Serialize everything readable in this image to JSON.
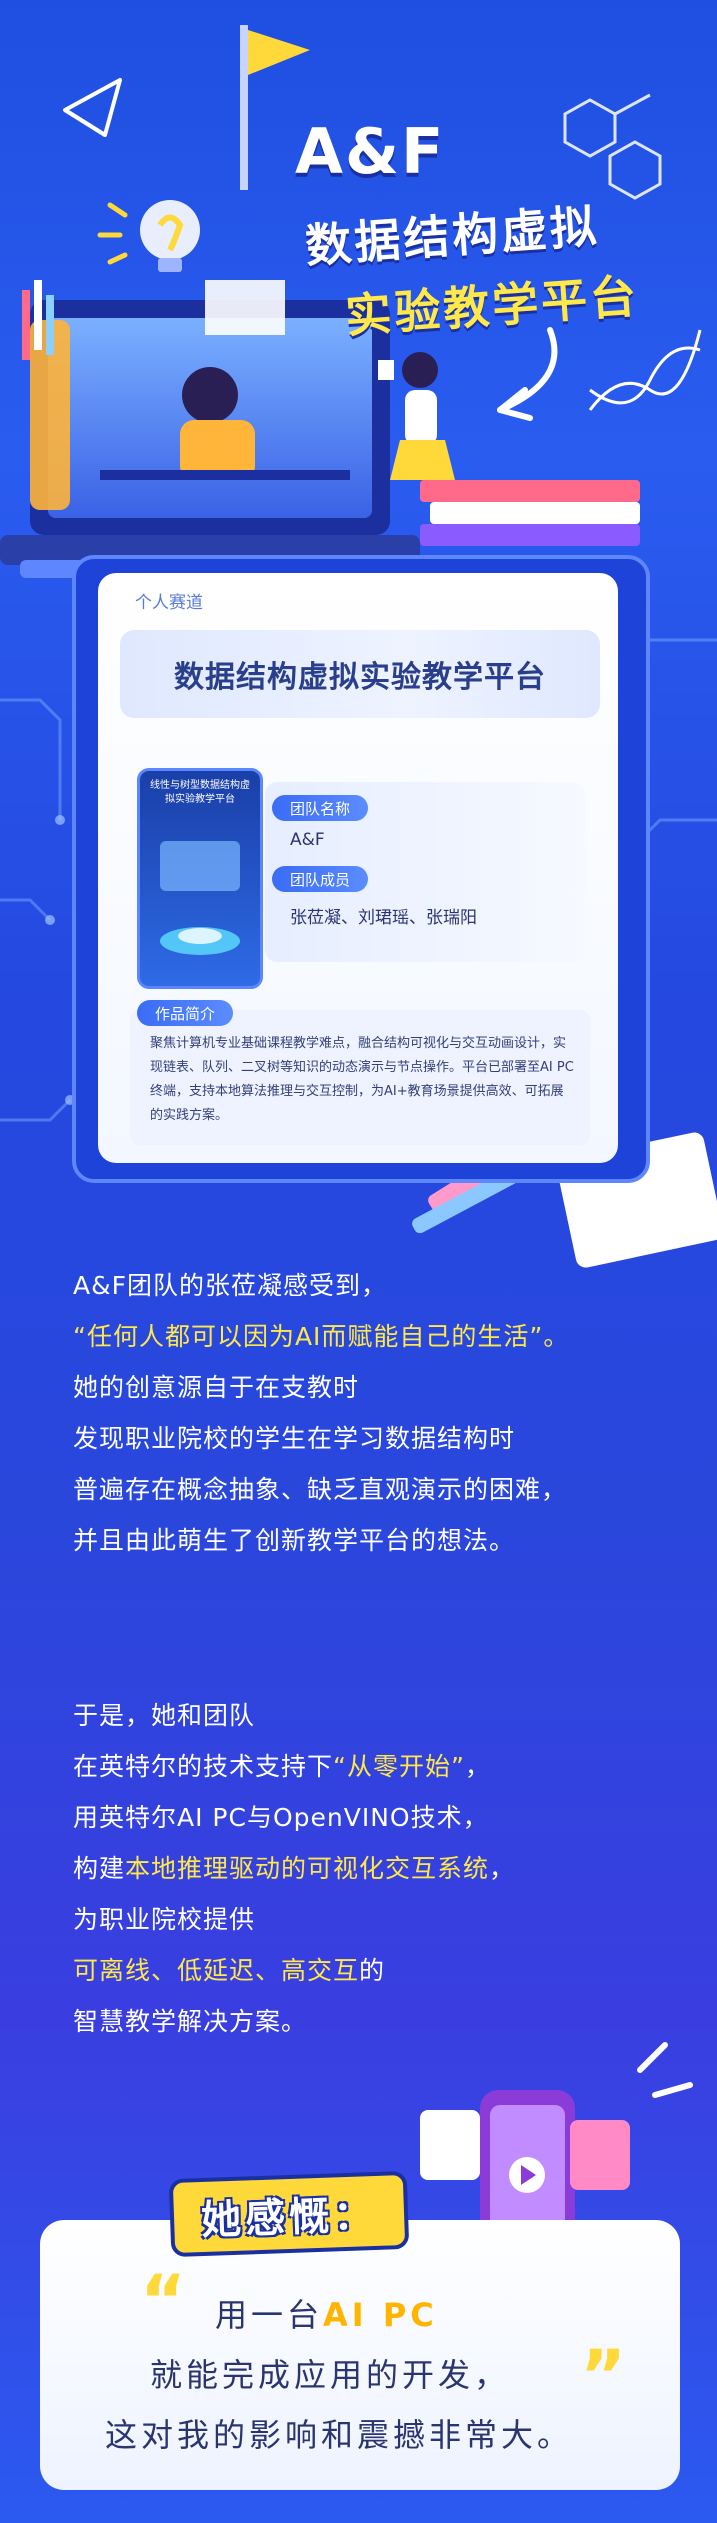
{
  "hero": {
    "title": "A&F",
    "subtitle_line1": "数据结构虚拟",
    "subtitle_line2": "实验教学平台"
  },
  "card": {
    "tag": "个人赛道",
    "title": "数据结构虚拟实验教学平台",
    "poster_caption": "线性与树型数据结构虚拟实验教学平台",
    "team_name_label": "团队名称",
    "team_name": "A&F",
    "team_members_label": "团队成员",
    "team_members": "张莅凝、刘珺瑶、张瑞阳",
    "intro_label": "作品简介",
    "intro_text": "聚焦计算机专业基础课程教学难点，融合结构可视化与交互动画设计，实现链表、队列、二叉树等知识的动态演示与节点操作。平台已部署至AI PC终端，支持本地算法推理与交互控制，为AI+教育场景提供高效、可拓展的实践方案。"
  },
  "story1": {
    "l1": "A&F团队的张莅凝感受到，",
    "l2": "“任何人都可以因为AI而赋能自己的生活”。",
    "l3": "她的创意源自于在支教时",
    "l4": "发现职业院校的学生在学习数据结构时",
    "l5": "普遍存在概念抽象、缺乏直观演示的困难，",
    "l6": "并且由此萌生了创新教学平台的想法。"
  },
  "story2": {
    "l1": "于是，她和团队",
    "l2a": "在英特尔的技术支持下",
    "l2b": "“从零开始”",
    "l2c": "，",
    "l3": "用英特尔AI PC与OpenVINO技术，",
    "l4a": "构建",
    "l4b": "本地推理驱动的可视化交互系统",
    "l4c": "，",
    "l5": "为职业院校提供",
    "l6a": "可离线、低延迟、高交互",
    "l6b": "的",
    "l7": "智慧教学解决方案。"
  },
  "quote": {
    "badge": "她感慨：",
    "open_mark": "“",
    "close_mark": "”",
    "l1a": "用一台",
    "l1b": "AI PC",
    "l2": "就能完成应用的开发，",
    "l3": "这对我的影响和震撼非常大。"
  },
  "colors": {
    "background": "#2448e0",
    "highlight": "#ffe84a",
    "card_title": "#2a3f8c",
    "pill": "#3a6cf5"
  }
}
